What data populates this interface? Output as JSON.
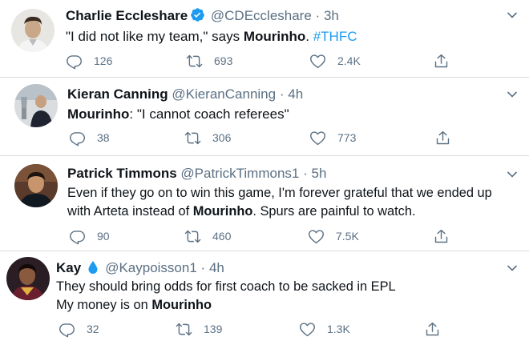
{
  "tweets": [
    {
      "name": "Charlie Eccleshare",
      "handle": "@CDEccleshare",
      "time": "3h",
      "verified": true,
      "body_pre": "\"I did not like my team,\" says ",
      "body_bold": "Mourinho",
      "body_post": ". ",
      "hashtag": "#THFC",
      "replies": "126",
      "retweets": "693",
      "likes": "2.4K"
    },
    {
      "name": "Kieran Canning",
      "handle": "@KieranCanning",
      "time": "4h",
      "body_bold": "Mourinho",
      "body_post": ": \"I cannot coach referees\"",
      "replies": "38",
      "retweets": "306",
      "likes": "773"
    },
    {
      "name": "Patrick Timmons",
      "handle": "@PatrickTimmons1",
      "time": "5h",
      "line1": "Even if they go on to win this game, I'm forever grateful that we ended up",
      "line2_pre": "with Arteta instead of ",
      "line2_bold": "Mourinho",
      "line2_post": ". Spurs are painful to watch.",
      "replies": "90",
      "retweets": "460",
      "likes": "7.5K"
    },
    {
      "name": "Kay",
      "handle": "@Kaypoisson1",
      "time": "4h",
      "line1": "They should bring odds for first coach to be sacked in EPL",
      "line2_pre": "My money is on ",
      "line2_bold": "Mourinho",
      "replies": "32",
      "retweets": "139",
      "likes": "1.3K"
    }
  ],
  "separator": "·",
  "colors": {
    "accent": "#1d9bf0",
    "secondary_text": "#5b7083",
    "divider": "#d7dbdc"
  },
  "icons": [
    "verified-badge-icon",
    "water-drop-icon",
    "caret-down-icon",
    "reply-icon",
    "retweet-icon",
    "like-icon",
    "share-icon"
  ]
}
